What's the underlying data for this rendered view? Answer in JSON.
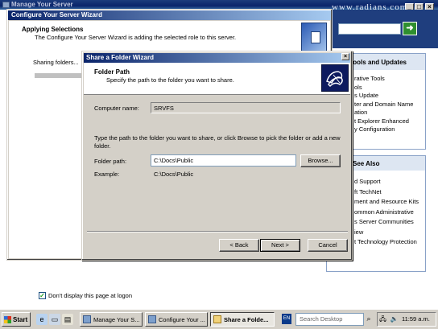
{
  "manage_server": {
    "title": "Manage Your Server",
    "watermark": "www.radians.com.ru",
    "tools_title": "Tools and Updates",
    "tools_items": [
      "Administrative Tools",
      "More Tools",
      "Windows Update",
      "Computer and Domain Name Information",
      "Internet Explorer Enhanced Security Configuration"
    ],
    "tools_items_visible": [
      "rative Tools",
      "ols",
      "s Update",
      "ter and Domain Name",
      "ation",
      "t Explorer Enhanced",
      "y Configuration"
    ],
    "help_title": "See Also",
    "help_items_visible": [
      "d Support",
      "ft TechNet",
      "ment and Resource Kits",
      "ommon Administrative",
      "s Server Communities",
      "iew",
      "t Technology Protection"
    ],
    "logon_label": "Don't display this page at logon",
    "logon_checked": true
  },
  "configure_wizard": {
    "title": "Configure Your Server Wizard",
    "heading": "Applying Selections",
    "subheading": "The Configure Your Server Wizard is adding the selected role to this server.",
    "status": "Sharing folders..."
  },
  "share_wizard": {
    "title": "Share a Folder Wizard",
    "close_glyph": "×",
    "heading": "Folder Path",
    "subheading": "Specify the path to the folder you want to share.",
    "computer_name_label": "Computer name:",
    "computer_name_value": "SRVFS",
    "instructions": "Type the path to the folder you want to share, or click Browse to pick the folder or add a new folder.",
    "folder_path_label": "Folder path:",
    "folder_path_value": "C:\\Docs\\Public",
    "browse_label": "Browse...",
    "example_label": "Example:",
    "example_value": "C:\\Docs\\Public",
    "back_label": "< Back",
    "next_label": "Next >",
    "cancel_label": "Cancel"
  },
  "taskbar": {
    "start_label": "Start",
    "tasks": [
      "Manage Your S...",
      "Configure Your ...",
      "Share a Folde..."
    ],
    "active_task": 2,
    "language": "EN",
    "search_placeholder": "Search Desktop",
    "clock": "11:59 a.m."
  }
}
